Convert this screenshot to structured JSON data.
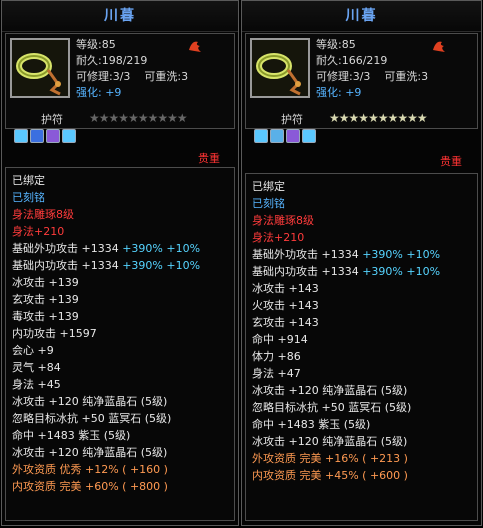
{
  "colors": {
    "title": "#6aa4f2",
    "stat": "#d8d8d8",
    "accent_blue": "#56b4ff",
    "red": "#ff3b3b",
    "green": "#74e05a",
    "orange": "#ff9a52"
  },
  "left": {
    "title": "川暮",
    "level": "等级:85",
    "durability": "耐久:198/219",
    "repair": "可修理:3/3",
    "rewash": "可重洗:3",
    "strength": "强化: +9",
    "amulet_label": "护符",
    "stars_on": 0,
    "stars_total": 10,
    "bound_note": "贵重",
    "lines": [
      {
        "text": "已绑定",
        "color": "c-white"
      },
      {
        "text": "已刻铭",
        "color": "c-blue"
      },
      {
        "text": "身法雕琢8级",
        "color": "c-red"
      },
      {
        "text": "身法+210",
        "color": "c-red"
      },
      {
        "text": "基础外功攻击 +1334 ",
        "extra": "+390% +10%",
        "color": "c-white"
      },
      {
        "text": "基础内功攻击 +1334 ",
        "extra": "+390% +10%",
        "color": "c-white"
      },
      {
        "text": "冰攻击 +139",
        "color": "c-white"
      },
      {
        "text": "玄攻击 +139",
        "color": "c-white"
      },
      {
        "text": "毒攻击 +139",
        "color": "c-white"
      },
      {
        "text": "内功攻击 +1597",
        "color": "c-white"
      },
      {
        "text": "会心 +9",
        "color": "c-white"
      },
      {
        "text": "灵气 +84",
        "color": "c-white"
      },
      {
        "text": "身法 +45",
        "color": "c-white"
      },
      {
        "text": "冰攻击 +120 纯净蓝晶石 (5级)",
        "color": "c-white"
      },
      {
        "text": "忽略目标冰抗 +50 蓝冥石 (5级)",
        "color": "c-white"
      },
      {
        "text": "命中 +1483 紫玉 (5级)",
        "color": "c-white"
      },
      {
        "text": "冰攻击 +120 纯净蓝晶石 (5级)",
        "color": "c-white"
      },
      {
        "text": "外攻资质  优秀 +12% ( +160 )",
        "color": "c-orange"
      },
      {
        "text": "内攻资质  完美 +60% ( +800 )",
        "color": "c-orange"
      }
    ]
  },
  "right": {
    "title": "川暮",
    "level": "等级:85",
    "durability": "耐久:166/219",
    "repair": "可修理:3/3",
    "rewash": "可重洗:3",
    "strength": "强化: +9",
    "amulet_label": "护符",
    "stars_on": 10,
    "stars_total": 10,
    "bound_note": "贵重",
    "lines": [
      {
        "text": "已绑定",
        "color": "c-white"
      },
      {
        "text": "已刻铭",
        "color": "c-blue"
      },
      {
        "text": "身法雕琢8级",
        "color": "c-red"
      },
      {
        "text": "身法+210",
        "color": "c-red"
      },
      {
        "text": "基础外功攻击 +1334 ",
        "extra": "+390% +10%",
        "color": "c-white"
      },
      {
        "text": "基础内功攻击 +1334 ",
        "extra": "+390% +10%",
        "color": "c-white"
      },
      {
        "text": "冰攻击 +143",
        "color": "c-white"
      },
      {
        "text": "火攻击 +143",
        "color": "c-white"
      },
      {
        "text": "玄攻击 +143",
        "color": "c-white"
      },
      {
        "text": "命中 +914",
        "color": "c-white"
      },
      {
        "text": "体力 +86",
        "color": "c-white"
      },
      {
        "text": "身法 +47",
        "color": "c-white"
      },
      {
        "text": "冰攻击 +120 纯净蓝晶石 (5级)",
        "color": "c-white"
      },
      {
        "text": "忽略目标冰抗 +50 蓝冥石 (5级)",
        "color": "c-white"
      },
      {
        "text": "命中 +1483 紫玉 (5级)",
        "color": "c-white"
      },
      {
        "text": "冰攻击 +120 纯净蓝晶石 (5级)",
        "color": "c-white"
      },
      {
        "text": "外攻资质  完美 +16% ( +213 )",
        "color": "c-orange"
      },
      {
        "text": "内攻资质  完美 +45% ( +600 )",
        "color": "c-orange"
      }
    ]
  }
}
